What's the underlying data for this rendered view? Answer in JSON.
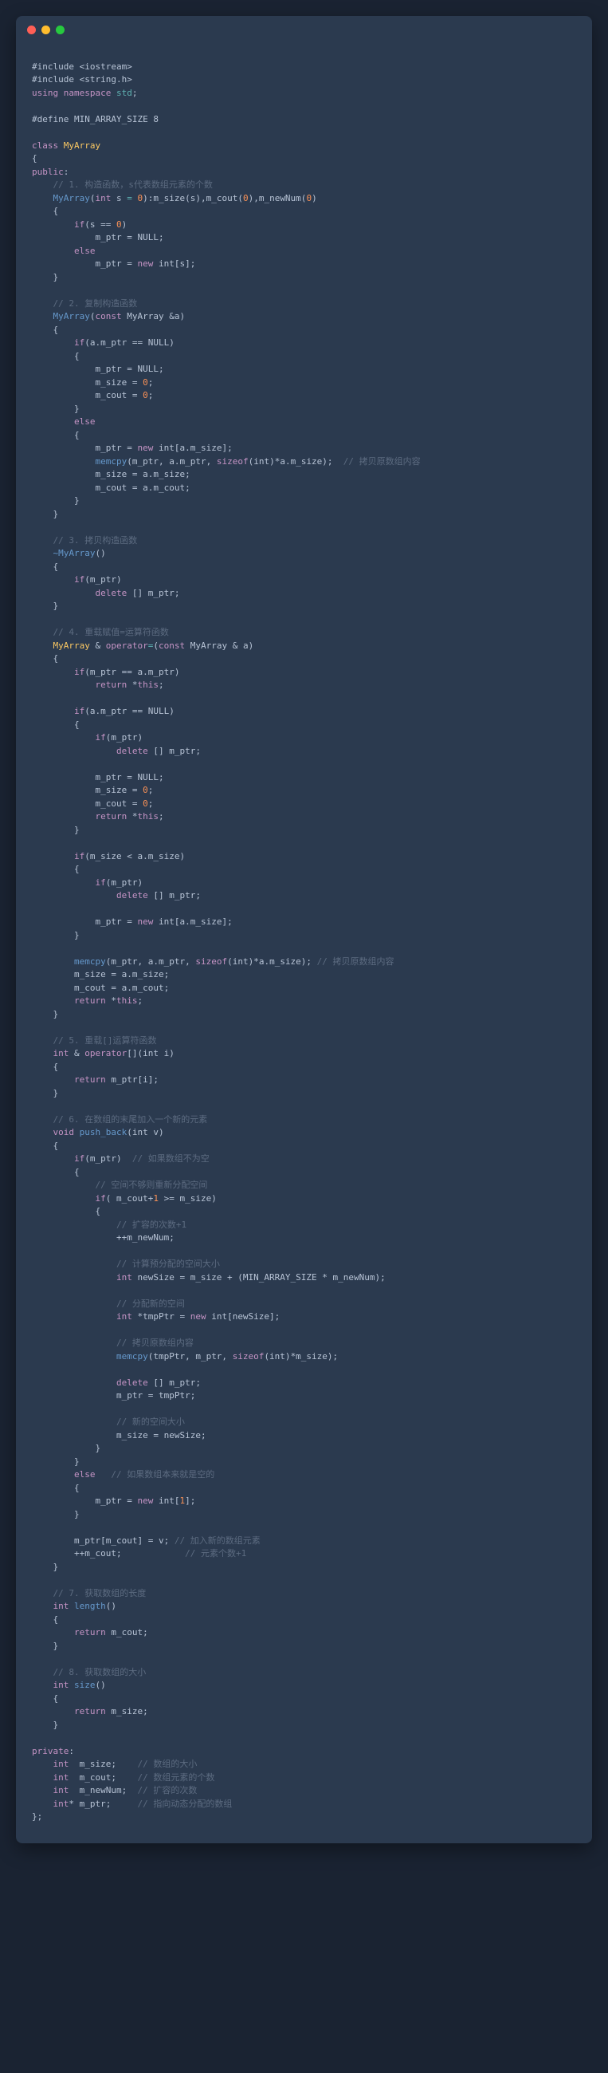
{
  "window": {
    "dots": [
      "red",
      "yellow",
      "green"
    ]
  },
  "code": {
    "include1": "#include <iostream>",
    "include2": "#include <string.h>",
    "using_kw": "using",
    "namespace_kw": "namespace",
    "std": "std",
    "semi": ";",
    "define_macro": "#define MIN_ARRAY_SIZE 8",
    "class_kw": "class",
    "class_name": "MyArray",
    "lbrace": "{",
    "rbrace": "}",
    "public_kw": "public",
    "private_kw": "private",
    "colon": ":",
    "c1": "// 1. 构造函数，s代表数组元素的个数",
    "ctor": "MyArray",
    "int_kw": "int",
    "void_kw": "void",
    "const_kw": "const",
    "param_s": " s ",
    "eq": "=",
    "zero": "0",
    "init_list": "):m_size(s),m_cout(",
    "init_list2": "),m_newNum(",
    "rparen": ")",
    "lparen": "(",
    "if_kw": "if",
    "else_kw": "else",
    "cond_s0": "(s == ",
    "mptr": "m_ptr",
    "assign_null": " = NULL;",
    "assign_new": " = ",
    "new_kw": "new",
    "int_arr_s": " int[s];",
    "c2": "// 2. 复制构造函数",
    "copy_param": " MyArray &a)",
    "cond_amptr_null": "(a.m_ptr == NULL)",
    "msize": "m_size",
    "mcout": "m_cout",
    "assign_0": " = ",
    "int_arr_amsize": " int[a.m_size];",
    "memcpy_fn": "memcpy",
    "memcpy_args1": "(m_ptr, a.m_ptr, ",
    "sizeof_kw": "sizeof",
    "sizeof_int": "(int)",
    "mult_amsize": "*a.m_size);",
    "c2_copy": "  // 拷贝原数组内容",
    "assign_amsize": " = a.m_size;",
    "assign_amcout": " = a.m_cout;",
    "c3": "// 3. 拷贝构造函数",
    "dtor": "~MyArray",
    "empty_parens": "()",
    "cond_mptr": "(m_ptr)",
    "delete_kw": "delete",
    "del_arr": " [] m_ptr;",
    "c4": "// 4. 重载赋值=运算符函数",
    "amp": " & ",
    "operator_kw": "operator",
    "op_eq": "=",
    "op_eq_param": " MyArray & a)",
    "cond_same": "(m_ptr == a.m_ptr)",
    "return_kw": "return",
    "this_kw": "this",
    "star_this": " *",
    "cond_msize_lt": "(m_size < a.m_size)",
    "mult_amsize2": "*a.m_size);",
    "c4_copy": " // 拷贝原数组内容",
    "c5": "// 5. 重载[]运算符函数",
    "op_bracket": "[]",
    "param_i": "(int i)",
    "ret_mptr_i": " m_ptr[i];",
    "c6": "// 6. 在数组的末尾加入一个新的元素",
    "push_back": "push_back",
    "param_v": "(int v)",
    "c6_notnull": "// 如果数组不为空",
    "c6_space": "// 空间不够则重新分配空间",
    "cond_cout_ge": "( m_cout+",
    "one": "1",
    "ge_msize": " >= m_size)",
    "c6_expand": "// 扩容的次数+1",
    "inc_newnum": "++m_newNum;",
    "c6_calc": "// 计算预分配的空间大小",
    "newsize_decl": " newSize = m_size + (MIN_ARRAY_SIZE * m_newNum);",
    "c6_alloc": "// 分配新的空间",
    "tmpptr_decl": " *tmpPtr = ",
    "int_arr_newsize": " int[newSize];",
    "c6_copy": "// 拷贝原数组内容",
    "memcpy_tmp": "(tmpPtr, m_ptr, ",
    "mult_msize": "*m_size);",
    "assign_tmpptr": " = tmpPtr;",
    "c6_newsize": "// 新的空间大小",
    "assign_newsize": " = newSize;",
    "c6_empty": "// 如果数组本来就是空的",
    "int_arr_1": " int[",
    "rbracket_semi": "];",
    "assign_v": "m_ptr[m_cout] = v;",
    "c6_addv": " // 加入新的数组元素",
    "inc_mcout": "++m_cout;",
    "c6_cnt": "// 元素个数+1",
    "c7": "// 7. 获取数组的长度",
    "length_fn": "length",
    "ret_mcout": " m_cout;",
    "c8": "// 8. 获取数组的大小",
    "size_fn": "size",
    "ret_msize": " m_size;",
    "mem_msize": "m_size;",
    "mem_mcout": "m_cout;",
    "mem_mnewnum": "m_newNum;",
    "mem_mptr": "m_ptr;",
    "cm1": "// 数组的大小",
    "cm2": "// 数组元素的个数",
    "cm3": "// 扩容的次数",
    "cm4": "// 指向动态分配的数组",
    "ptr_star": "* ",
    "space4": "    ",
    "space3": "   ",
    "end_semi": "};"
  }
}
